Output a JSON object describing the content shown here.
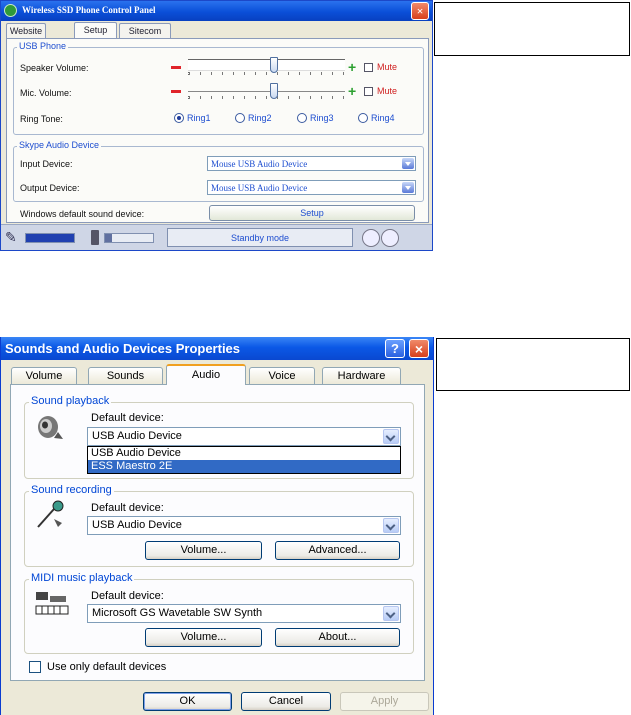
{
  "phone_panel": {
    "title": "Wireless SSD Phone Control Panel",
    "tabs": [
      {
        "label": "Website",
        "active": false
      },
      {
        "label": "Setup",
        "active": true
      },
      {
        "label": "Sitecom",
        "active": false
      }
    ],
    "usb_phone": {
      "group_label": "USB Phone",
      "speaker_volume_label": "Speaker Volume:",
      "speaker_volume_level": 0.55,
      "mic_volume_label": "Mic. Volume:",
      "mic_volume_level": 0.55,
      "mute_label": "Mute",
      "ring_tone_label": "Ring Tone:",
      "ring_options": [
        "Ring1",
        "Ring2",
        "Ring3",
        "Ring4"
      ],
      "ring_selected": "Ring1"
    },
    "skype_audio": {
      "group_label": "Skype Audio Device",
      "input_label": "Input Device:",
      "input_value": "Mouse USB Audio Device",
      "output_label": "Output Device:",
      "output_value": "Mouse USB Audio Device"
    },
    "default_sound_label": "Windows default sound device:",
    "setup_button": "Setup",
    "status_text": "Standby mode",
    "signal_level": 1.0,
    "battery_level": 0.15
  },
  "sound_props": {
    "title": "Sounds and Audio Devices Properties",
    "help_glyph": "?",
    "close_glyph": "×",
    "tabs": [
      {
        "label": "Volume",
        "active": false
      },
      {
        "label": "Sounds",
        "active": false
      },
      {
        "label": "Audio",
        "active": true
      },
      {
        "label": "Voice",
        "active": false
      },
      {
        "label": "Hardware",
        "active": false
      }
    ],
    "playback": {
      "group_label": "Sound playback",
      "default_label": "Default device:",
      "selected": "USB Audio Device",
      "options": [
        "USB Audio Device",
        "ESS Maestro 2E"
      ],
      "highlighted": "ESS Maestro 2E"
    },
    "recording": {
      "group_label": "Sound recording",
      "default_label": "Default device:",
      "selected": "USB Audio Device",
      "volume_button": "Volume...",
      "advanced_button": "Advanced..."
    },
    "midi": {
      "group_label": "MIDI music playback",
      "default_label": "Default device:",
      "selected": "Microsoft GS Wavetable SW Synth",
      "volume_button": "Volume...",
      "about_button": "About..."
    },
    "use_default_label": "Use only default devices",
    "use_default_checked": false,
    "ok": "OK",
    "cancel": "Cancel",
    "apply": "Apply"
  }
}
